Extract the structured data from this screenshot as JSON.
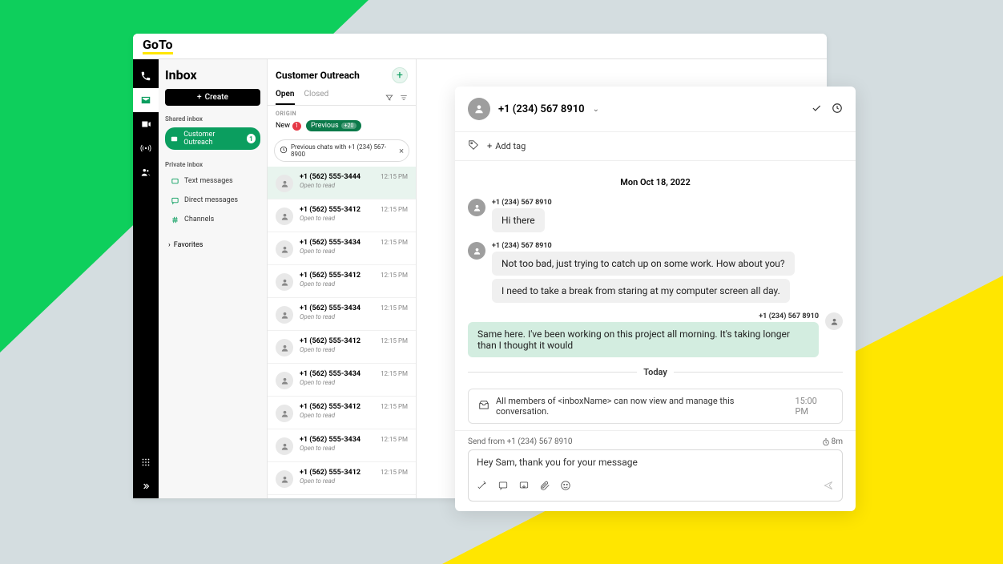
{
  "brand": "GoTo",
  "inbox": {
    "title": "Inbox",
    "create_label": "Create",
    "shared_label": "Shared inbox",
    "private_label": "Private inbox",
    "shared_items": [
      {
        "label": "Customer Outreach",
        "badge": "1",
        "selected": true
      }
    ],
    "private_items": [
      {
        "label": "Text messages",
        "icon": "sms"
      },
      {
        "label": "Direct messages",
        "icon": "dm"
      },
      {
        "label": "Channels",
        "icon": "hash"
      }
    ],
    "favorites_label": "Favorites"
  },
  "list": {
    "title": "Customer Outreach",
    "tabs": {
      "open": "Open",
      "closed": "Closed"
    },
    "origin_label": "ORIGIN",
    "new_label": "New",
    "new_count": "1",
    "prev_label": "Previous",
    "prev_count": "+20",
    "prev_chat_text": "Previous chats with +1 (234) 567-8900",
    "conversations": [
      {
        "number": "+1 (562) 555-3444",
        "sub": "Open to read",
        "time": "12:15 PM",
        "active": true
      },
      {
        "number": "+1 (562) 555-3412",
        "sub": "Open to read",
        "time": "12:15 PM"
      },
      {
        "number": "+1 (562) 555-3434",
        "sub": "Open to read",
        "time": "12:15 PM"
      },
      {
        "number": "+1 (562) 555-3412",
        "sub": "Open to read",
        "time": "12:15 PM"
      },
      {
        "number": "+1 (562) 555-3434",
        "sub": "Open to read",
        "time": "12:15 PM"
      },
      {
        "number": "+1 (562) 555-3412",
        "sub": "Open to read",
        "time": "12:15 PM"
      },
      {
        "number": "+1 (562) 555-3434",
        "sub": "Open to read",
        "time": "12:15 PM"
      },
      {
        "number": "+1 (562) 555-3412",
        "sub": "Open to read",
        "time": "12:15 PM"
      },
      {
        "number": "+1 (562) 555-3434",
        "sub": "Open to read",
        "time": "12:15 PM"
      },
      {
        "number": "+1 (562) 555-3412",
        "sub": "Open to read",
        "time": "12:15 PM"
      }
    ]
  },
  "chat": {
    "title": "+1 (234) 567 8910",
    "add_tag": "Add tag",
    "date1": "Mon Oct 18, 2022",
    "date2": "Today",
    "msgs": [
      {
        "from": "+1 (234) 567 8910",
        "bubbles": [
          "Hi there"
        ],
        "mine": false
      },
      {
        "from": "+1 (234) 567 8910",
        "bubbles": [
          "Not too bad, just trying to catch up on some work. How about you?",
          "I need to take a break from staring at my computer screen all day."
        ],
        "mine": false
      },
      {
        "from": "+1 (234) 567 8910",
        "bubbles": [
          "Same here. I've been working on this project all morning. It's taking longer than I thought it would"
        ],
        "mine": true
      }
    ],
    "sys": {
      "text": "All members of <inboxName> can now view and manage this conversation.",
      "time": "15:00 PM"
    },
    "composer": {
      "send_from": "Send from +1 (234) 567 8910",
      "timer": "8m",
      "value": "Hey Sam, thank you for your message"
    }
  }
}
